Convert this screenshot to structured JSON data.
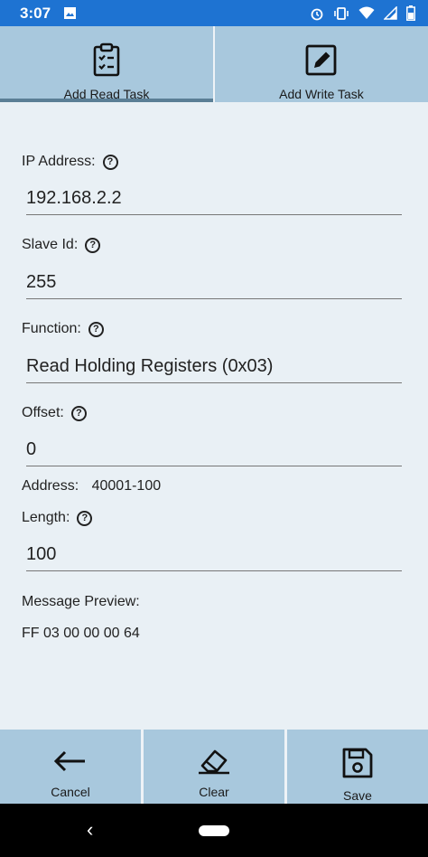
{
  "status_bar": {
    "time": "3:07"
  },
  "tabs": [
    {
      "label": "Add Read Task",
      "icon": "clipboard-check-icon"
    },
    {
      "label": "Add Write Task",
      "icon": "edit-icon"
    }
  ],
  "form": {
    "ip": {
      "label": "IP Address:",
      "value": "192.168.2.2"
    },
    "slave": {
      "label": "Slave Id:",
      "value": "255"
    },
    "function": {
      "label": "Function:",
      "value": "Read Holding Registers (0x03)"
    },
    "offset": {
      "label": "Offset:",
      "value": "0"
    },
    "address": {
      "label": "Address:",
      "value": "40001-100"
    },
    "length": {
      "label": "Length:",
      "value": "100"
    },
    "preview": {
      "label": "Message Preview:",
      "value": "FF 03 00 00 00 64"
    }
  },
  "bottom_bar": {
    "cancel": "Cancel",
    "clear": "Clear",
    "save": "Save"
  },
  "nav": {
    "back": "‹"
  }
}
